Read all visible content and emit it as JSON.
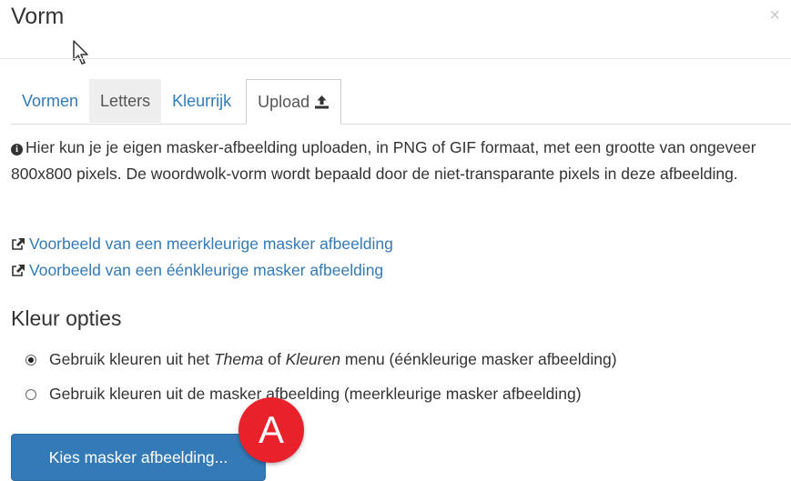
{
  "dialog": {
    "title": "Vorm",
    "close_symbol": "×"
  },
  "tabs": [
    {
      "label": "Vormen",
      "active": false
    },
    {
      "label": "Letters",
      "active": false
    },
    {
      "label": "Kleurrijk",
      "active": false
    },
    {
      "label": "Upload",
      "active": true,
      "icon": "upload-icon"
    }
  ],
  "info": {
    "icon": "info-circle-icon",
    "text": "Hier kun je je eigen masker-afbeelding uploaden, in PNG of GIF formaat, met een grootte van ongeveer 800x800 pixels. De woordwolk-vorm wordt bepaald door de niet-transparante pixels in deze afbeelding."
  },
  "links": [
    {
      "label": "Voorbeeld van een meerkleurige masker afbeelding",
      "icon": "external-link-icon"
    },
    {
      "label": "Voorbeeld van een éénkleurige masker afbeelding",
      "icon": "external-link-icon"
    }
  ],
  "color_options": {
    "heading": "Kleur opties",
    "option1": {
      "before": "Gebruik kleuren uit het ",
      "em1": "Thema",
      "mid": " of ",
      "em2": "Kleuren",
      "after": " menu (éénkleurige masker afbeelding)",
      "checked": true
    },
    "option2": {
      "label": "Gebruik kleuren uit de masker afbeelding (meerkleurige masker afbeelding)",
      "checked": false
    }
  },
  "button": {
    "label": "Kies masker afbeelding..."
  },
  "annotation": {
    "label": "A",
    "color": "#e8212b"
  },
  "colors": {
    "link": "#337ab7",
    "button": "#337ab7"
  }
}
